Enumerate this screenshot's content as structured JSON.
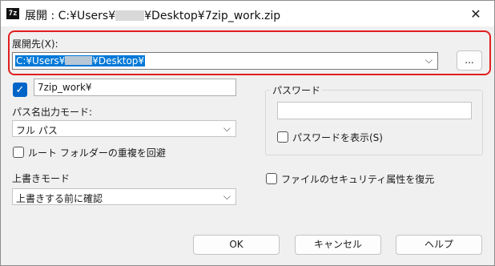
{
  "window": {
    "icon_text": "7z",
    "title_prefix": "展開 : C:¥Users¥",
    "title_suffix": "¥Desktop¥7zip_work.zip",
    "close_glyph": "✕"
  },
  "extract_to": {
    "label": "展開先(X):",
    "value_prefix": "C:¥Users¥",
    "value_suffix": "¥Desktop¥",
    "browse_label": "..."
  },
  "subfolder": {
    "checked": true,
    "value": "7zip_work¥"
  },
  "path_mode": {
    "label": "パス名出力モード:",
    "selected": "フル パス"
  },
  "eliminate_duplication": {
    "label": "ルート フォルダーの重複を回避",
    "checked": false
  },
  "overwrite_mode": {
    "label": "上書きモード",
    "selected": "上書きする前に確認"
  },
  "password": {
    "group_label": "パスワード",
    "value": "",
    "show_label": "パスワードを表示(S)",
    "show_checked": false
  },
  "restore_security": {
    "label": "ファイルのセキュリティ属性を復元",
    "checked": false
  },
  "buttons": {
    "ok": "OK",
    "cancel": "キャンセル",
    "help": "ヘルプ"
  },
  "icons": {
    "chevron": "chevron-down-icon",
    "check": "checkmark-icon",
    "close": "close-icon"
  }
}
